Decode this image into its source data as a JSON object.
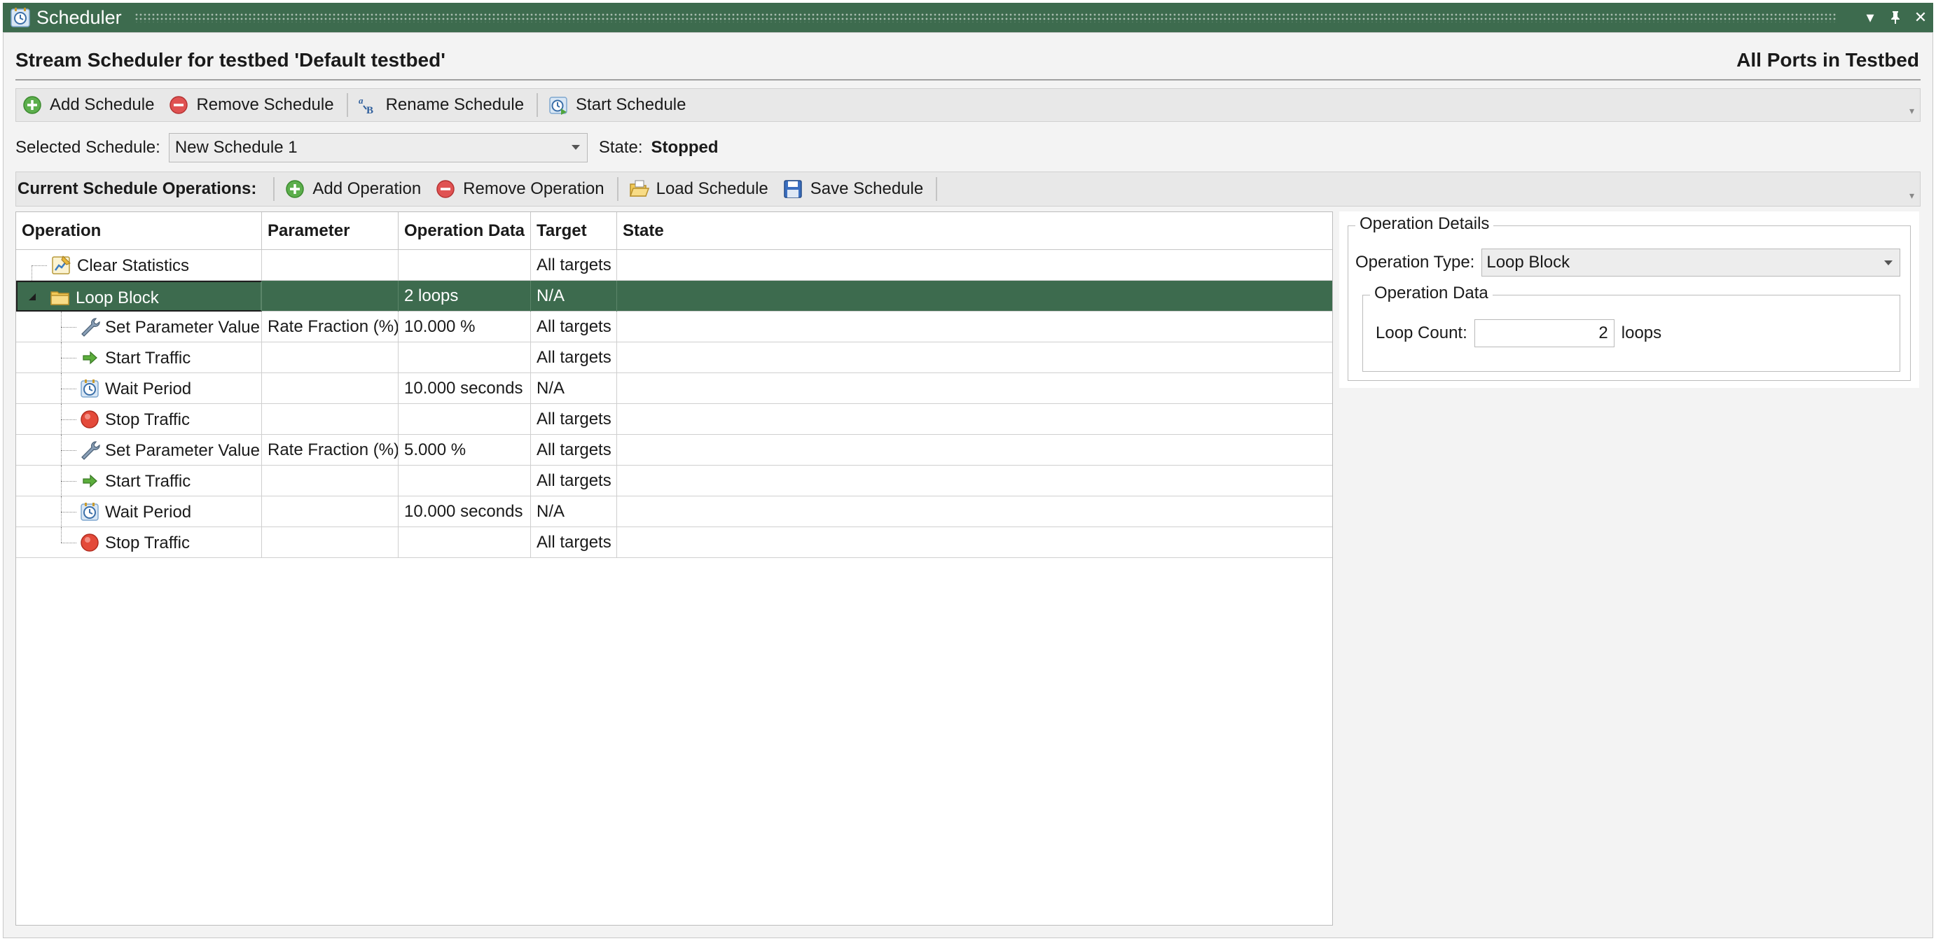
{
  "window": {
    "title": "Scheduler"
  },
  "page": {
    "title": "Stream Scheduler for testbed 'Default testbed'",
    "scope": "All Ports in Testbed"
  },
  "schedule_toolbar": {
    "add": "Add Schedule",
    "remove": "Remove Schedule",
    "rename": "Rename Schedule",
    "start": "Start Schedule"
  },
  "selection": {
    "label": "Selected Schedule:",
    "value": "New Schedule 1",
    "state_label": "State:",
    "state_value": "Stopped"
  },
  "ops_toolbar": {
    "label": "Current Schedule Operations:",
    "add": "Add Operation",
    "remove": "Remove Operation",
    "load": "Load Schedule",
    "save": "Save Schedule"
  },
  "grid": {
    "columns": [
      "Operation",
      "Parameter",
      "Operation Data",
      "Target",
      "State"
    ],
    "rows": [
      {
        "operation": "Clear Statistics",
        "parameter": "",
        "data": "",
        "target": "All targets",
        "state": "",
        "icon": "clear-stats-icon",
        "depth": 0
      },
      {
        "operation": "Loop Block",
        "parameter": "",
        "data": "2 loops",
        "target": "N/A",
        "state": "",
        "icon": "folder-icon",
        "depth": 0,
        "expanded": true,
        "selected": true
      },
      {
        "operation": "Set Parameter Value",
        "parameter": "Rate Fraction (%)",
        "data": "10.000 %",
        "target": "All targets",
        "state": "",
        "icon": "wrench-icon",
        "depth": 1
      },
      {
        "operation": "Start Traffic",
        "parameter": "",
        "data": "",
        "target": "All targets",
        "state": "",
        "icon": "green-arrow-icon",
        "depth": 1
      },
      {
        "operation": "Wait Period",
        "parameter": "",
        "data": "10.000 seconds",
        "target": "N/A",
        "state": "",
        "icon": "clock-icon",
        "depth": 1
      },
      {
        "operation": "Stop Traffic",
        "parameter": "",
        "data": "",
        "target": "All targets",
        "state": "",
        "icon": "stop-icon",
        "depth": 1
      },
      {
        "operation": "Set Parameter Value",
        "parameter": "Rate Fraction (%)",
        "data": "5.000 %",
        "target": "All targets",
        "state": "",
        "icon": "wrench-icon",
        "depth": 1
      },
      {
        "operation": "Start Traffic",
        "parameter": "",
        "data": "",
        "target": "All targets",
        "state": "",
        "icon": "green-arrow-icon",
        "depth": 1
      },
      {
        "operation": "Wait Period",
        "parameter": "",
        "data": "10.000 seconds",
        "target": "N/A",
        "state": "",
        "icon": "clock-icon",
        "depth": 1
      },
      {
        "operation": "Stop Traffic",
        "parameter": "",
        "data": "",
        "target": "All targets",
        "state": "",
        "icon": "stop-icon",
        "depth": 1
      }
    ]
  },
  "details": {
    "group_title": "Operation Details",
    "type_label": "Operation Type:",
    "type_value": "Loop Block",
    "data_group_title": "Operation Data",
    "loop_label": "Loop Count:",
    "loop_value": "2",
    "loop_unit": "loops"
  },
  "colors": {
    "accent": "#3d6b4e",
    "selection": "#3d6b4e",
    "toolbar_bg": "#e8e8e8"
  }
}
